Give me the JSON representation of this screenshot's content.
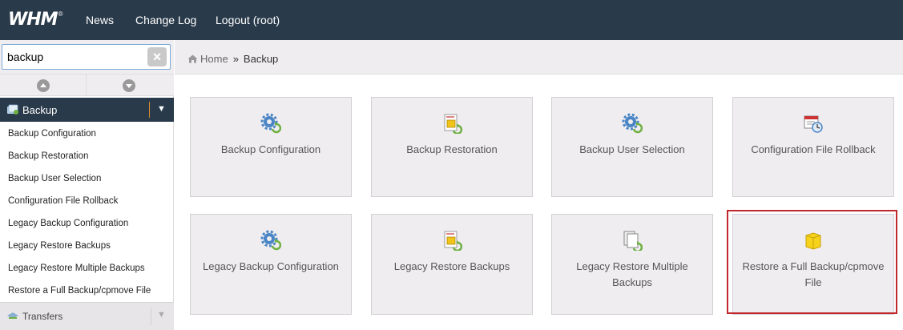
{
  "topbar": {
    "logo_text": "WHM",
    "logo_mark": "®",
    "nav": [
      "News",
      "Change Log",
      "Logout (root)"
    ]
  },
  "sidebar": {
    "search": {
      "value": "backup",
      "placeholder": ""
    },
    "clear_icon": "×",
    "category": {
      "label": "Backup",
      "caret": "▼",
      "icon": "backup-category-icon"
    },
    "items": [
      "Backup Configuration",
      "Backup Restoration",
      "Backup User Selection",
      "Configuration File Rollback",
      "Legacy Backup Configuration",
      "Legacy Restore Backups",
      "Legacy Restore Multiple Backups",
      "Restore a Full Backup/cpmove File"
    ],
    "next_category": {
      "label": "Transfers",
      "caret": "▼",
      "icon": "transfers-category-icon"
    }
  },
  "breadcrumb": {
    "home": "Home",
    "separator": "»",
    "current": "Backup"
  },
  "tiles": [
    {
      "label": "Backup Configuration",
      "icon": "gear-icon"
    },
    {
      "label": "Backup Restoration",
      "icon": "restore-icon"
    },
    {
      "label": "Backup User Selection",
      "icon": "gear-icon"
    },
    {
      "label": "Configuration File Rollback",
      "icon": "rollback-icon"
    },
    {
      "label": "Legacy Backup Configuration",
      "icon": "gear-icon"
    },
    {
      "label": "Legacy Restore Backups",
      "icon": "restore-icon"
    },
    {
      "label": "Legacy Restore Multiple Backups",
      "icon": "documents-icon"
    },
    {
      "label": "Restore a Full Backup/cpmove File",
      "icon": "box-icon",
      "highlighted": true
    }
  ],
  "colors": {
    "topbar": "#293a4a",
    "panel": "#f0edf0",
    "highlight": "#c0282d",
    "accent_divider": "#e08a30"
  }
}
